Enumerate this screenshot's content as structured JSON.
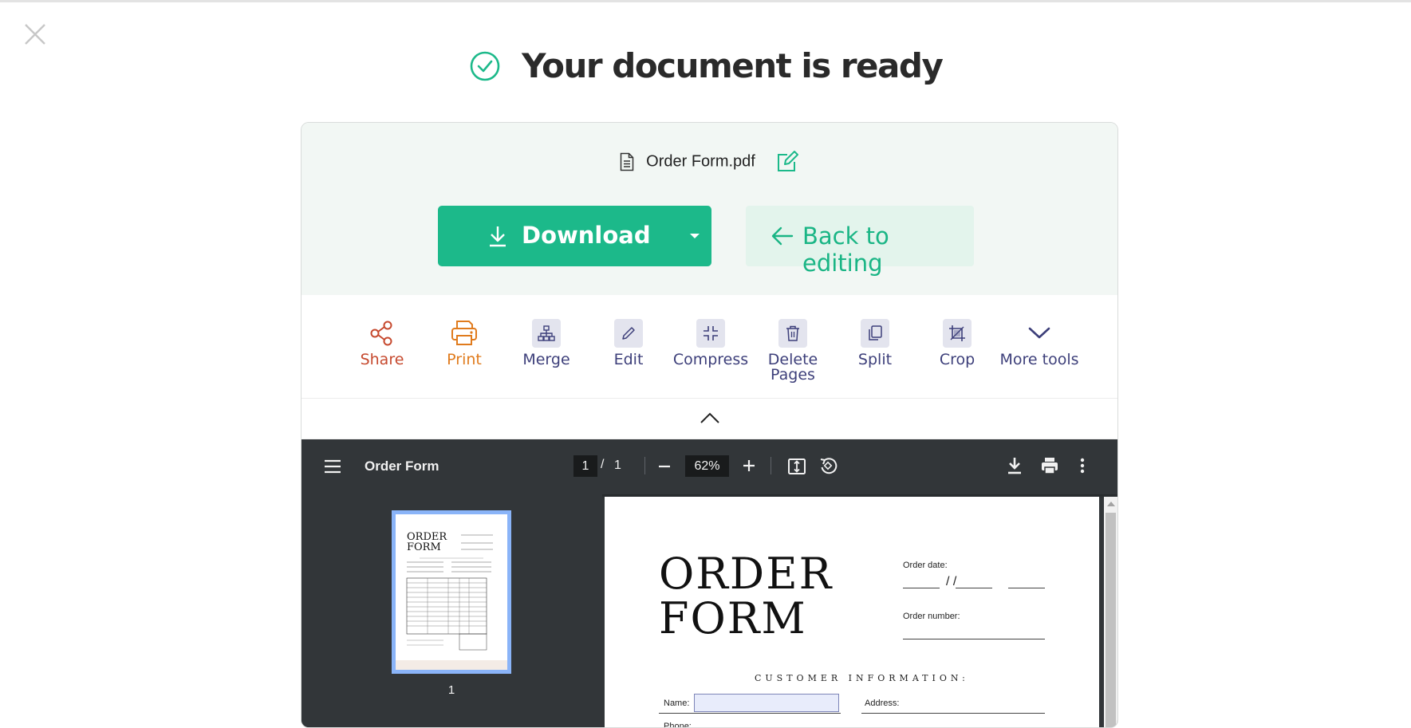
{
  "header": {
    "title": "Your document is ready",
    "close_icon": "close-icon",
    "check_icon": "check-circle-icon",
    "accent_color": "#1cb98a"
  },
  "file": {
    "name": "Order Form.pdf",
    "icon": "document-icon",
    "edit_icon": "edit-pencil-icon"
  },
  "actions": {
    "download_label": "Download",
    "download_icon": "download-arrow-icon",
    "dropdown_icon": "caret-down-icon",
    "back_label": "Back to editing",
    "back_icon": "arrow-left-icon"
  },
  "tools": [
    {
      "label": "Share",
      "icon": "share-icon",
      "color": "#c6492e"
    },
    {
      "label": "Print",
      "icon": "printer-icon",
      "color": "#e07b1d"
    },
    {
      "label": "Merge",
      "icon": "merge-icon"
    },
    {
      "label": "Edit",
      "icon": "pencil-icon"
    },
    {
      "label": "Compress",
      "icon": "compress-icon"
    },
    {
      "label": "Delete Pages",
      "icon": "trash-icon"
    },
    {
      "label": "Split",
      "icon": "split-icon"
    },
    {
      "label": "Crop",
      "icon": "crop-icon"
    },
    {
      "label": "More tools",
      "icon": "chevron-down-icon"
    }
  ],
  "viewer": {
    "doc_title": "Order Form",
    "page_current": "1",
    "page_separator": "/",
    "page_total": "1",
    "zoom": "62%",
    "thumbnail_page_number": "1"
  },
  "document": {
    "title_line1": "ORDER",
    "title_line2": "FORM",
    "order_date_label": "Order date:",
    "order_date_slashes": "/          /",
    "order_number_label": "Order number:",
    "customer_info_label": "CUSTOMER INFORMATION:",
    "name_label": "Name:",
    "address_label": "Address:",
    "phone_label": "Phone:"
  }
}
